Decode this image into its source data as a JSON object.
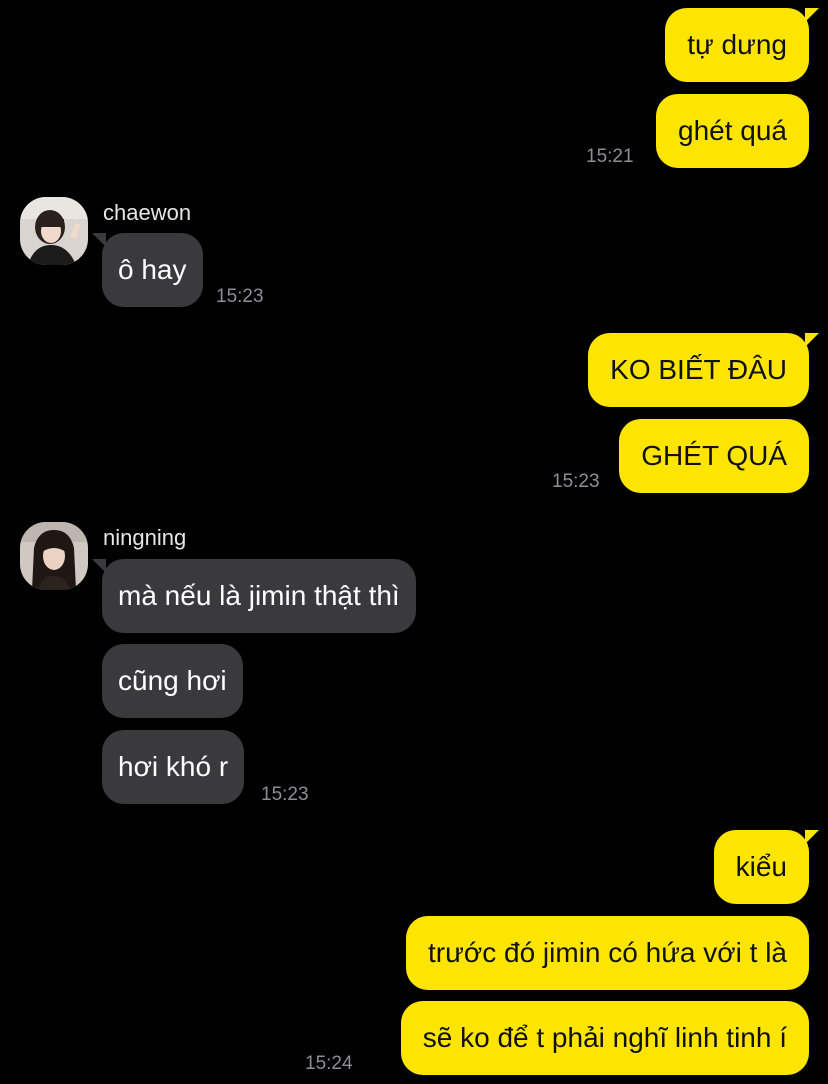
{
  "colors": {
    "background": "#000000",
    "outgoing_bubble": "#FEE500",
    "incoming_bubble": "#3A3A3C",
    "timestamp": "#8E8E93"
  },
  "groups": {
    "g1": {
      "messages": [
        "tự dưng",
        "ghét quá"
      ],
      "time": "15:21"
    },
    "g2": {
      "sender": "chaewon",
      "avatar_icon": "chaewon-avatar-icon",
      "messages": [
        "ô hay"
      ],
      "time": "15:23"
    },
    "g3": {
      "messages": [
        "KO BIẾT ĐÂU",
        "GHÉT QUÁ"
      ],
      "time": "15:23"
    },
    "g4": {
      "sender": "ningning",
      "avatar_icon": "ningning-avatar-icon",
      "messages": [
        "mà nếu là jimin thật thì",
        "cũng hơi",
        "hơi khó r"
      ],
      "time": "15:23"
    },
    "g5": {
      "messages": [
        "kiểu",
        "trước đó jimin có hứa với t là",
        "sẽ ko để t phải nghĩ linh tinh í"
      ],
      "time": "15:24"
    }
  }
}
